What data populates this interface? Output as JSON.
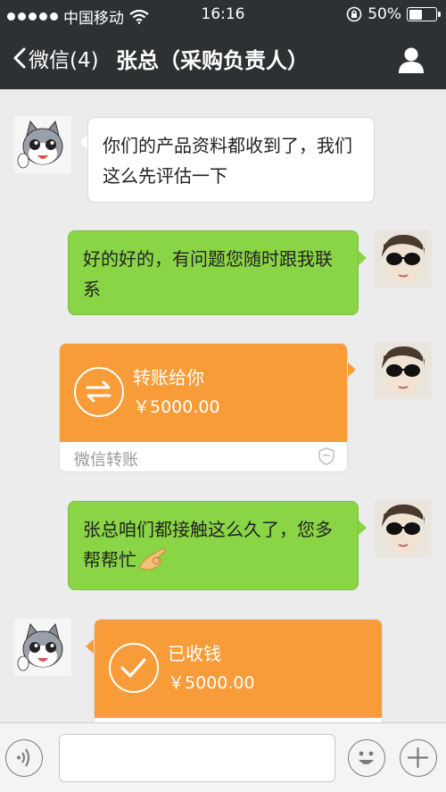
{
  "status_bar": {
    "carrier": "中国移动",
    "time": "16:16",
    "battery": "50%",
    "battery_level": 0.5
  },
  "nav": {
    "back_label": "微信(4)",
    "title": "张总（采购负责人）"
  },
  "messages": [
    {
      "side": "in",
      "kind": "text",
      "text": "你们的产品资料都收到了，我们这么先评估一下"
    },
    {
      "side": "out",
      "kind": "text",
      "text": "好的好的，有问题您随时跟我联系"
    },
    {
      "side": "out",
      "kind": "transfer",
      "title": "转账给你",
      "amount": "￥5000.00",
      "footer": "微信转账"
    },
    {
      "side": "out",
      "kind": "text",
      "text": "张总咱们都接触这么久了，您多帮帮忙"
    },
    {
      "side": "in",
      "kind": "transfer",
      "title": "已收钱",
      "amount": "￥5000.00"
    }
  ],
  "colors": {
    "header": "#2e3133",
    "chat_bg": "#ececec",
    "bubble_out": "#8ad546",
    "transfer_orange": "#f79c39"
  },
  "icons": [
    "wifi-icon",
    "lock-rotation-icon",
    "battery-icon",
    "back-chevron-icon",
    "profile-icon",
    "transfer-arrows-icon",
    "checkmark-icon",
    "shield-icon",
    "voice-icon",
    "emoji-icon",
    "plus-icon",
    "ok-hand-emoji-icon"
  ]
}
